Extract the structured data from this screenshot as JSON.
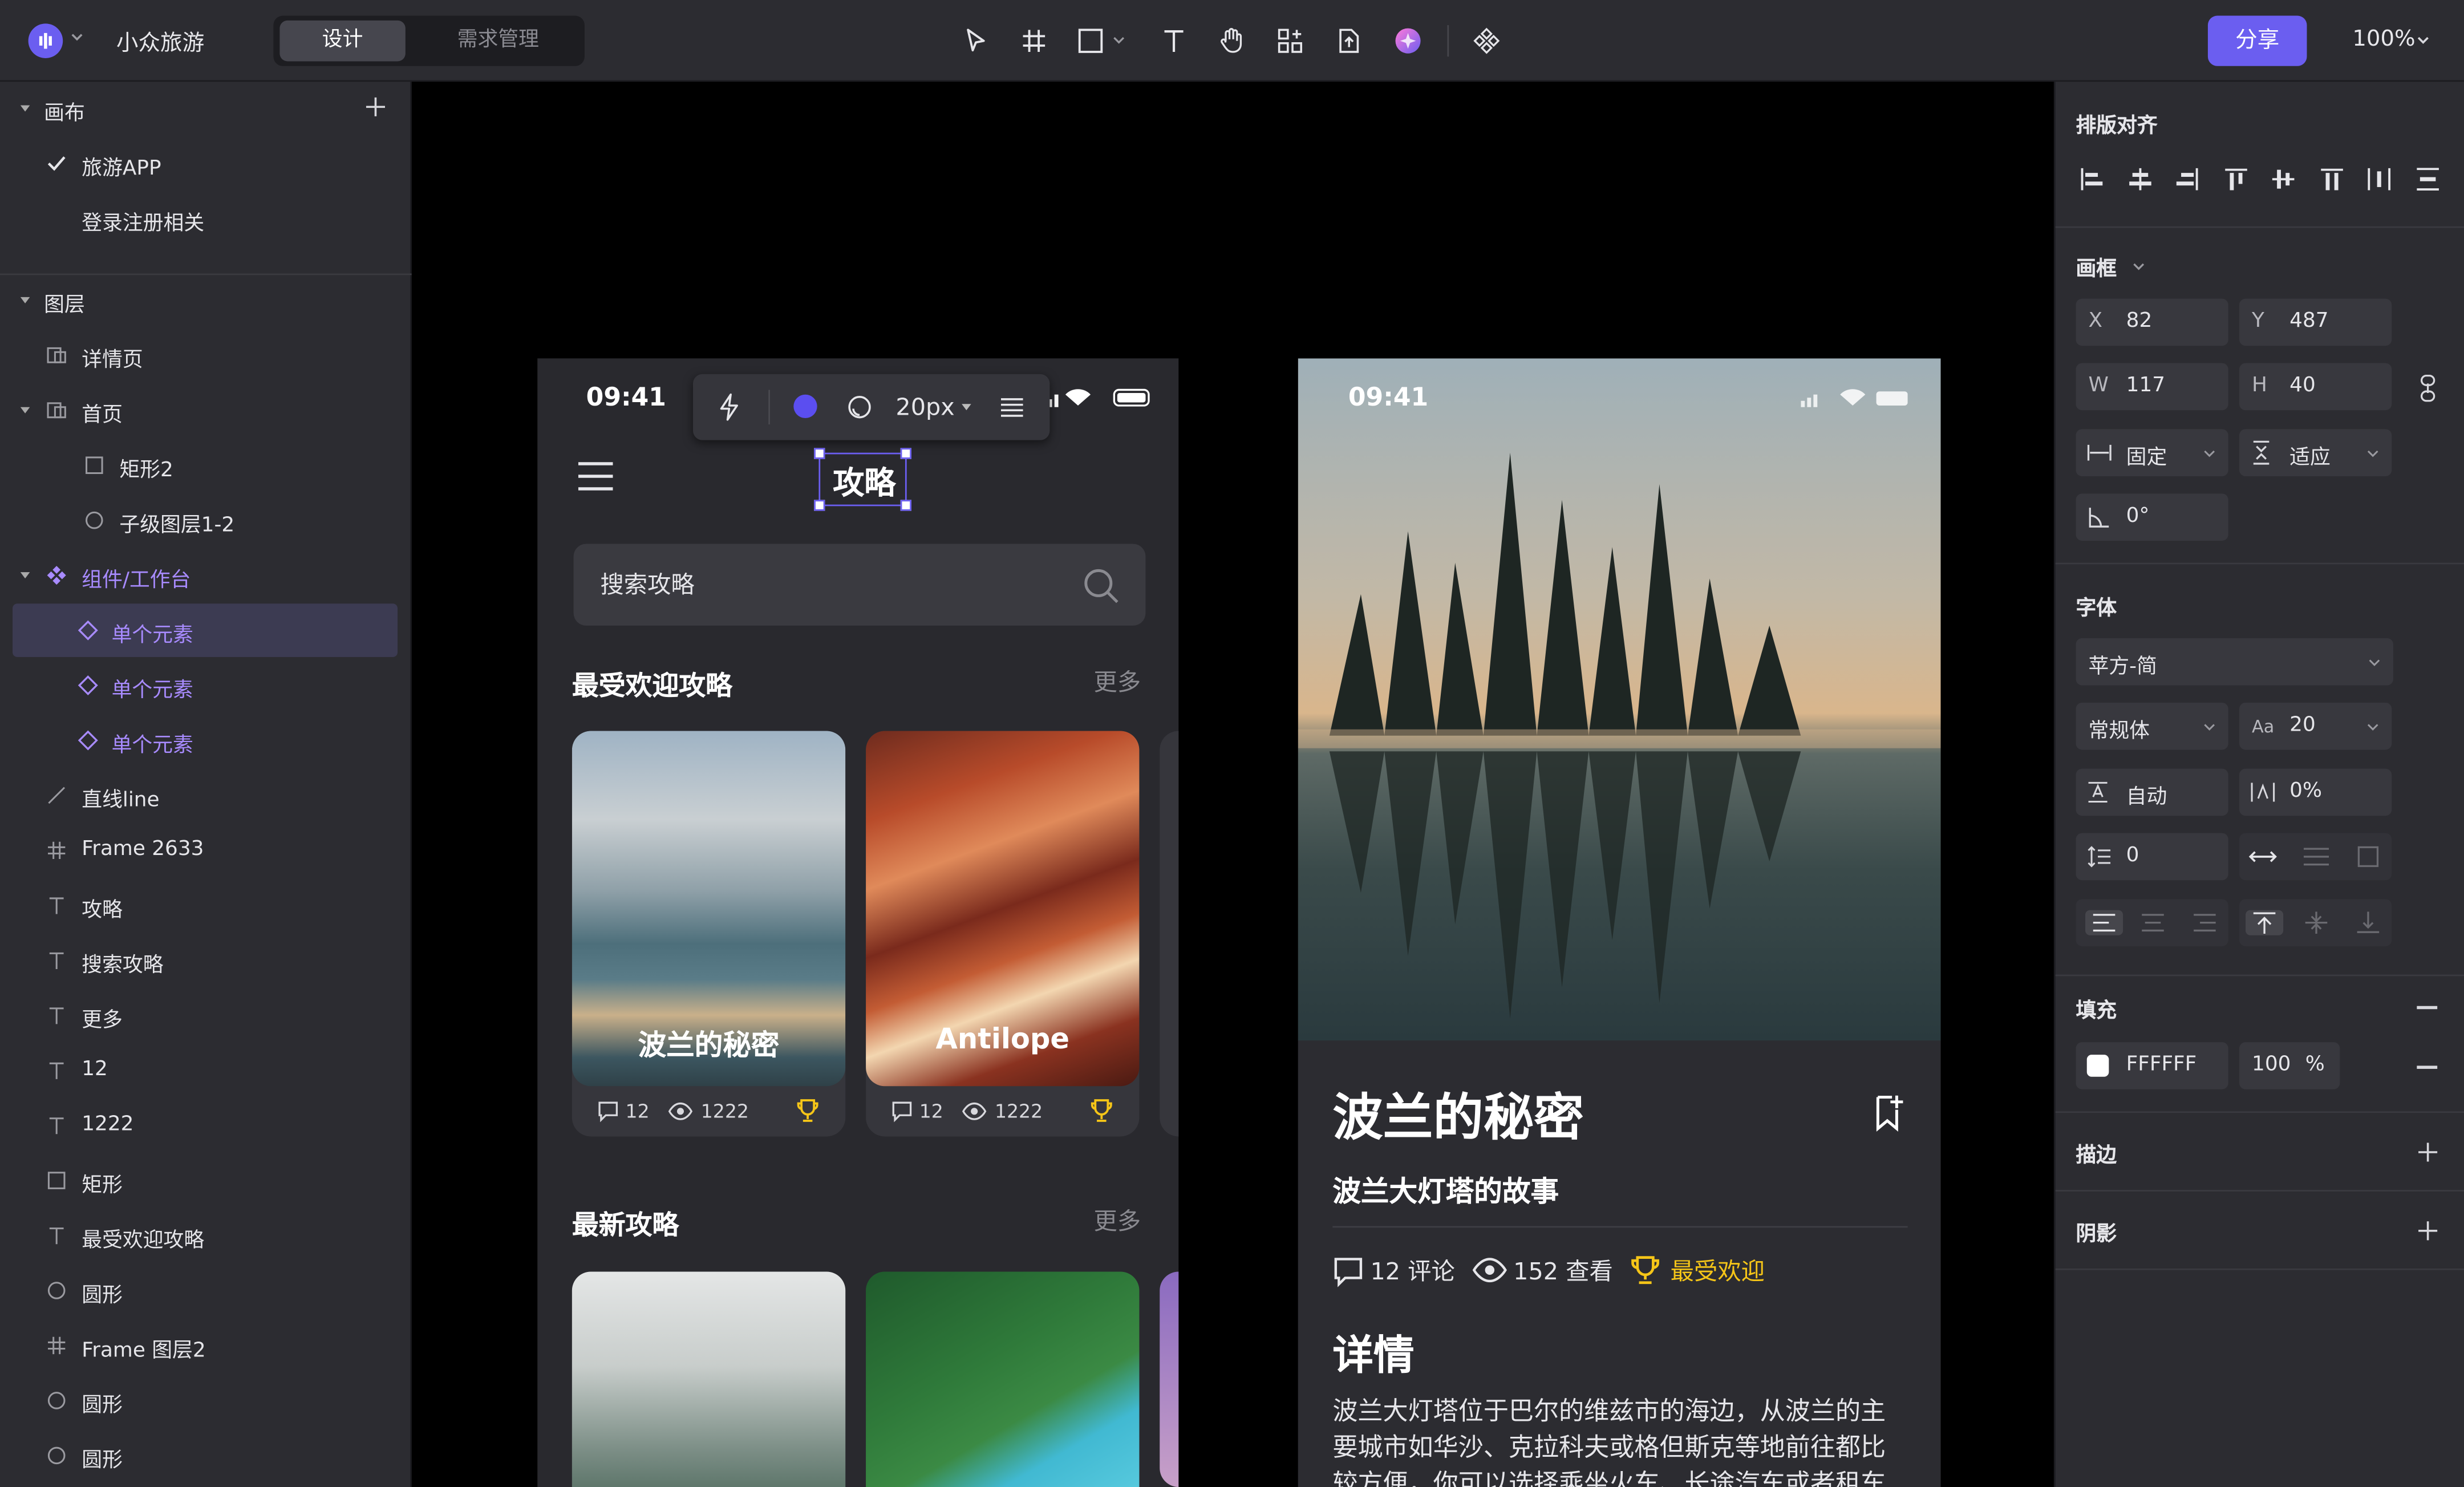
{
  "app": {
    "project_name": "小众旅游",
    "zoom": "100%",
    "share_label": "分享"
  },
  "mode_tabs": [
    {
      "label": "设计",
      "active": true
    },
    {
      "label": "需求管理",
      "active": false
    }
  ],
  "toolbar": [
    "move-icon",
    "frame-icon",
    "rectangle-icon",
    "text-icon",
    "hand-icon",
    "components-icon",
    "export-icon",
    "ai-plugin-icon",
    "component-icon"
  ],
  "left_panel": {
    "canvas_section": {
      "title": "画布",
      "pages": [
        {
          "label": "旅游APP",
          "checked": true
        },
        {
          "label": "登录注册相关",
          "checked": false
        }
      ]
    },
    "layers_section": {
      "title": "图层",
      "layers": [
        {
          "label": "详情页",
          "icon": "frame-group-icon"
        },
        {
          "label": "首页",
          "icon": "frame-group-icon"
        },
        {
          "label": "矩形2",
          "icon": "rectangle-icon"
        },
        {
          "label": "子级图层1-2",
          "icon": "circle-icon"
        },
        {
          "label": "组件/工作台",
          "icon": "component-icon"
        },
        {
          "label": "单个元素",
          "icon": "instance-icon"
        },
        {
          "label": "单个元素",
          "icon": "instance-icon"
        },
        {
          "label": "单个元素",
          "icon": "instance-icon"
        },
        {
          "label": "直线line",
          "icon": "line-icon"
        },
        {
          "label": "Frame 2633",
          "icon": "frame-icon"
        },
        {
          "label": "攻略",
          "icon": "text-icon"
        },
        {
          "label": "搜索攻略",
          "icon": "text-icon"
        },
        {
          "label": "更多",
          "icon": "text-icon"
        },
        {
          "label": "12",
          "icon": "text-icon"
        },
        {
          "label": "1222",
          "icon": "text-icon"
        },
        {
          "label": "矩形",
          "icon": "rectangle-icon"
        },
        {
          "label": "最受欢迎攻略",
          "icon": "text-icon"
        },
        {
          "label": "圆形",
          "icon": "circle-icon"
        },
        {
          "label": "Frame 图层2",
          "icon": "frame-icon"
        },
        {
          "label": "圆形",
          "icon": "circle-icon"
        },
        {
          "label": "圆形",
          "icon": "circle-icon"
        }
      ]
    }
  },
  "right_panel": {
    "align_title": "排版对齐",
    "frame_title": "画框",
    "x_label": "X",
    "x": "82",
    "y_label": "Y",
    "y": "487",
    "w_label": "W",
    "w": "117",
    "h_label": "H",
    "h": "40",
    "width_mode": "固定",
    "height_mode": "适应",
    "rotation": "0°",
    "font_title": "字体",
    "font_family": "苹方-简",
    "font_weight": "常规体",
    "font_size_label": "Aa",
    "font_size": "20",
    "line_height": "自动",
    "letter_spacing": "0%",
    "paragraph_spacing": "0",
    "fill_title": "填充",
    "fill_color": "FFFFFF",
    "fill_opacity": "100",
    "fill_opacity_unit": "%",
    "stroke_title": "描边",
    "shadow_title": "阴影"
  },
  "phone_home": {
    "time": "09:41",
    "title": "攻略",
    "search_placeholder": "搜索攻略",
    "popular_title": "最受欢迎攻略",
    "latest_title": "最新攻略",
    "more": "更多",
    "text_toolbar": {
      "size": "20px",
      "color": "#5b4ef0"
    },
    "cards": [
      {
        "caption": "波兰的秘密",
        "comments": "12",
        "views": "1222"
      },
      {
        "caption": "Antilope",
        "comments": "12",
        "views": "1222"
      }
    ]
  },
  "phone_detail": {
    "time": "09:41",
    "title": "波兰的秘密",
    "subtitle": "波兰大灯塔的故事",
    "comments": "12 评论",
    "views": "152 查看",
    "badge": "最受欢迎",
    "section_title": "详情",
    "body": "波兰大灯塔位于巴尔的维兹市的海边，从波兰的主要城市如华沙、克拉科夫或格但斯克等地前往都比较方便，你可以选择乘坐火车、长途汽车或者租车"
  },
  "colors": {
    "accent": "#6b5ef0",
    "purple_text": "#a88bff",
    "badge": "#f5c518",
    "panel": "#2c2c31"
  }
}
